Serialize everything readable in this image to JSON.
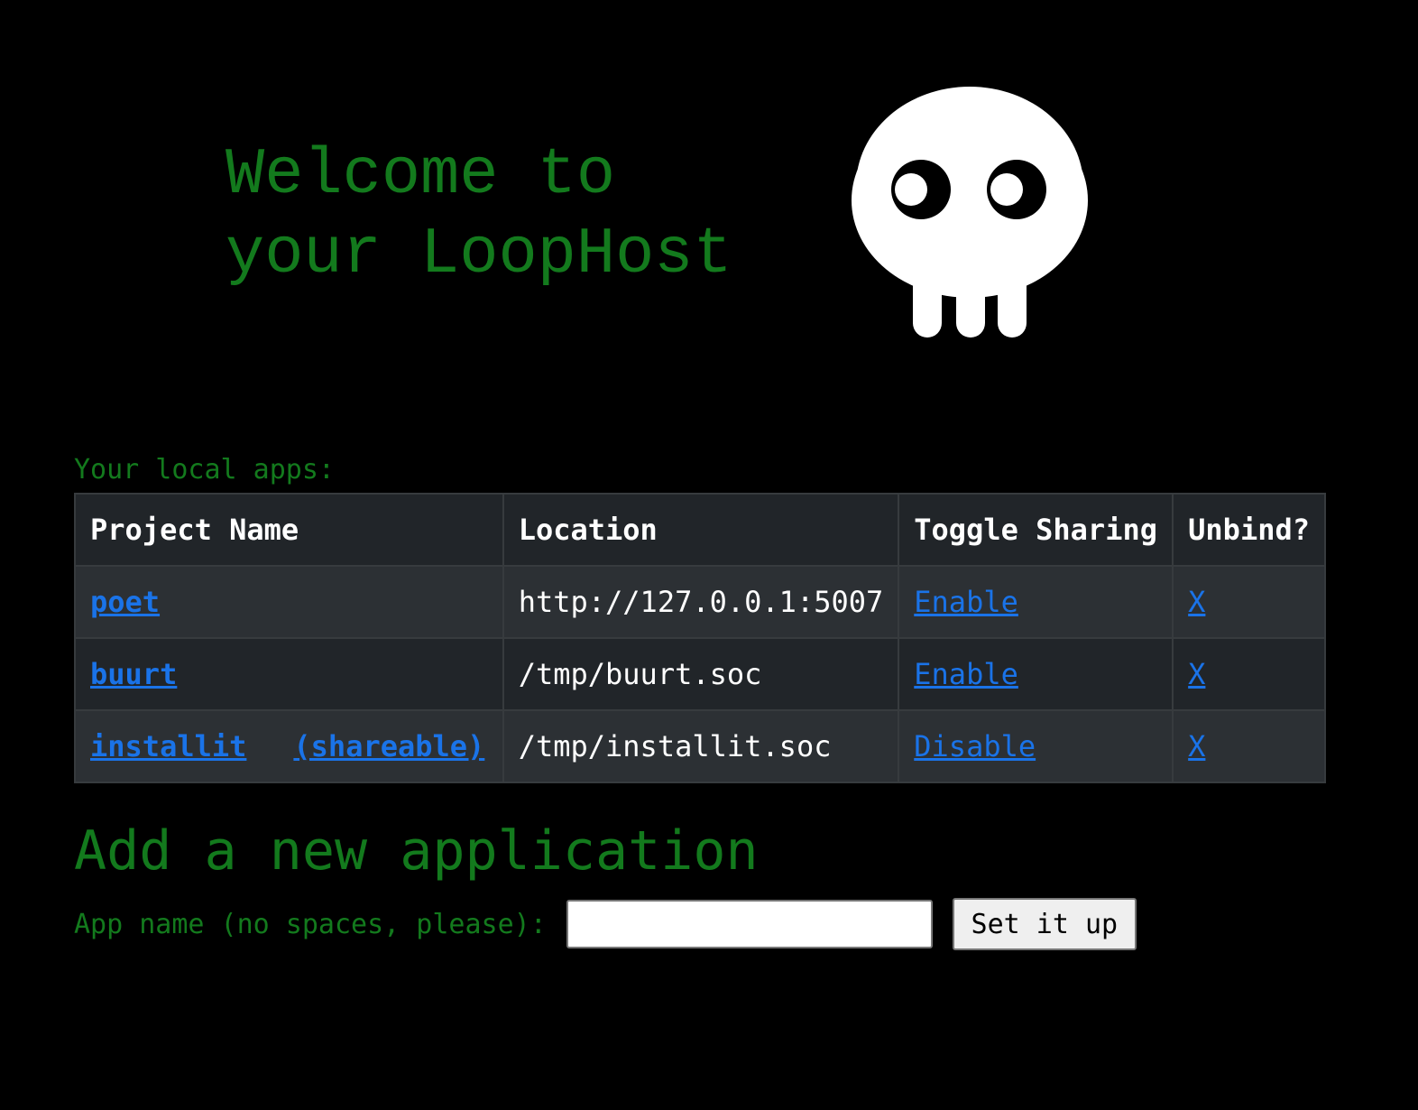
{
  "header": {
    "title_line1": "Welcome to",
    "title_line2": "your LoopHost",
    "logo_icon": "skull-icon"
  },
  "apps": {
    "label": "Your local apps:",
    "columns": [
      "Project Name",
      "Location",
      "Toggle Sharing",
      "Unbind?"
    ],
    "rows": [
      {
        "name": "poet",
        "shareable_tag": "",
        "location": "http://127.0.0.1:5007",
        "toggle": "Enable",
        "unbind": "X"
      },
      {
        "name": "buurt",
        "shareable_tag": "",
        "location": "/tmp/buurt.soc",
        "toggle": "Enable",
        "unbind": "X"
      },
      {
        "name": "installit",
        "shareable_tag": "(shareable)",
        "location": "/tmp/installit.soc",
        "toggle": "Disable",
        "unbind": "X"
      }
    ]
  },
  "add_form": {
    "title": "Add a new application",
    "label": "App name (no spaces, please):",
    "input_value": "",
    "submit_label": "Set it up"
  },
  "colors": {
    "background": "#000000",
    "accent_green": "#137a1d",
    "link_blue": "#1a73e8",
    "table_dark": "#212529",
    "table_stripe": "#2c3034"
  }
}
